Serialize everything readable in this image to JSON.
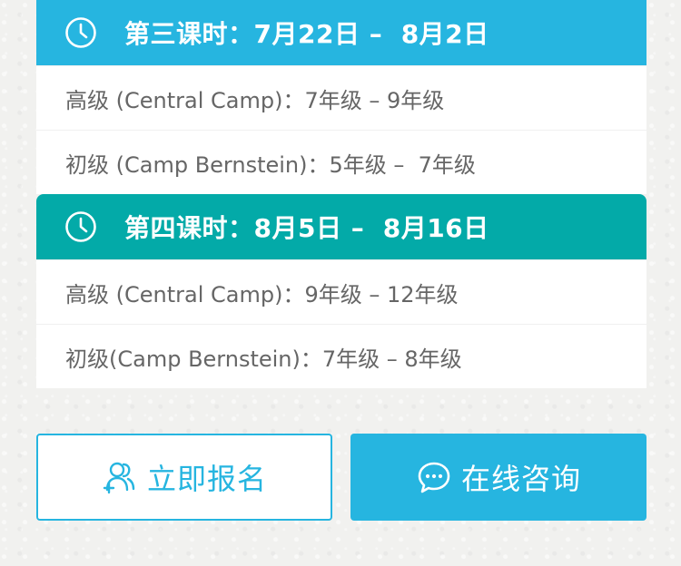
{
  "colors": {
    "session3_header": "#26b5e0",
    "session4_header": "#03aaa8",
    "accent": "#26b5e0",
    "row_text": "#666666",
    "page_bg": "#f1f1ef"
  },
  "sessions": [
    {
      "icon": "clock-icon",
      "title": "第三课时：7月22日 –  8月2日",
      "rows": [
        "高级 (Central Camp)：7年级 – 9年级",
        "初级 (Camp Bernstein)：5年级 –  7年级"
      ]
    },
    {
      "icon": "clock-icon",
      "title": "第四课时：8月5日 –  8月16日",
      "rows": [
        "高级 (Central Camp)：9年级 – 12年级",
        "初级(Camp Bernstein)：7年级 – 8年级"
      ]
    }
  ],
  "buttons": {
    "signup": {
      "label": "立即报名",
      "icon": "add-user-icon"
    },
    "consult": {
      "label": "在线咨询",
      "icon": "chat-bubble-icon"
    }
  }
}
